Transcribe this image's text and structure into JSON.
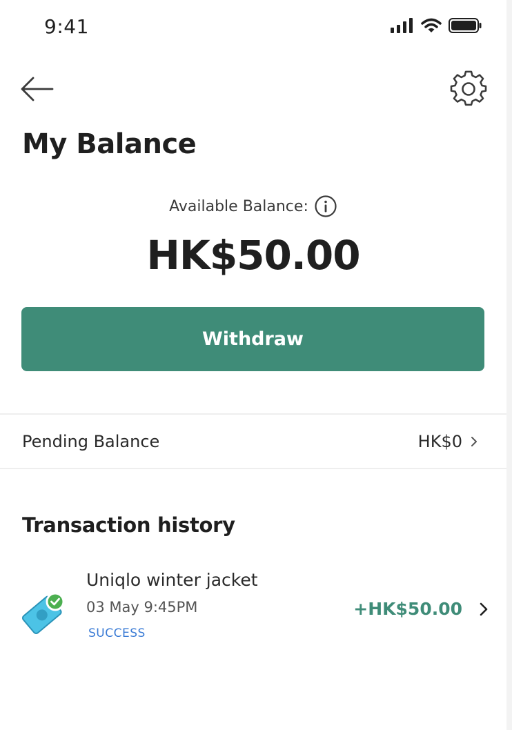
{
  "status_bar": {
    "time": "9:41",
    "icons": [
      "signal-icon",
      "wifi-icon",
      "battery-icon"
    ]
  },
  "header": {
    "back_icon": "arrow-left-icon",
    "settings_icon": "gear-icon",
    "title": "My Balance"
  },
  "balance": {
    "label": "Available Balance:",
    "info_icon": "info-icon",
    "amount": "HK$50.00"
  },
  "withdraw": {
    "label": "Withdraw"
  },
  "pending": {
    "label": "Pending Balance",
    "value": "HK$0",
    "chevron_icon": "chevron-right-icon"
  },
  "transactions": {
    "title": "Transaction history",
    "items": [
      {
        "icon": "payment-success-icon",
        "name": "Uniqlo winter jacket",
        "date": "03 May 9:45PM",
        "status": "SUCCESS",
        "amount": "+HK$50.00"
      }
    ]
  },
  "colors": {
    "accent": "#3f8c78",
    "status_success": "#3a7bd5",
    "icon_blue": "#4cc3e6",
    "check_green": "#4caf50"
  }
}
